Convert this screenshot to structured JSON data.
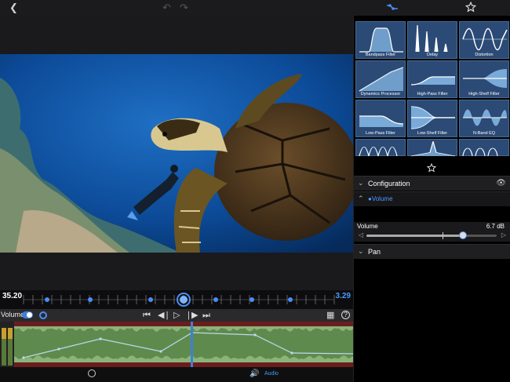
{
  "toolbar": {
    "back_icon": "chevron-left-icon",
    "undo_icon": "undo-icon",
    "redo_icon": "redo-icon",
    "automation_icon": "automation-curve-icon",
    "favorite_icon": "star-icon"
  },
  "timeline": {
    "start_time": "35.20",
    "end_time": "3.29",
    "playhead_position_percent": 52
  },
  "control_bar": {
    "track_label": "Volume",
    "toggle_on": true,
    "transport": [
      "skip-back-icon",
      "step-back-icon",
      "play-icon",
      "step-forward-icon",
      "skip-forward-icon"
    ],
    "right_icons": [
      "clapper-icon",
      "help-icon"
    ]
  },
  "bottom_bar": {
    "speed_icon": "speed-icon",
    "audio_label": "Audio",
    "audio_icon": "speaker-icon"
  },
  "effects": {
    "tiles": [
      {
        "label": "Bandpass Filter",
        "shape": "bandpass"
      },
      {
        "label": "Delay",
        "shape": "delay"
      },
      {
        "label": "Distortion",
        "shape": "distortion"
      },
      {
        "label": "Dynamics Processor",
        "shape": "dynamics"
      },
      {
        "label": "High-Pass Filter",
        "shape": "highpass"
      },
      {
        "label": "High-Shelf Filter",
        "shape": "highshelf"
      },
      {
        "label": "Low-Pass Filter",
        "shape": "lowpass"
      },
      {
        "label": "Low-Shelf Filter",
        "shape": "lowshelf"
      },
      {
        "label": "N-Band EQ",
        "shape": "nband"
      },
      {
        "label": "",
        "shape": "peaks"
      },
      {
        "label": "",
        "shape": "spike"
      },
      {
        "label": "",
        "shape": "arcs"
      }
    ]
  },
  "configuration": {
    "title": "Configuration",
    "subsection": "●Volume",
    "visibility_icon": "eye-icon",
    "volume_label": "Volume",
    "volume_value": "6.7 dB",
    "volume_fraction": 0.74
  },
  "pan": {
    "title": "Pan"
  },
  "colors": {
    "accent": "#4a8ef5",
    "tile_bg": "#2b4a75",
    "waveform": "#9abf86"
  }
}
